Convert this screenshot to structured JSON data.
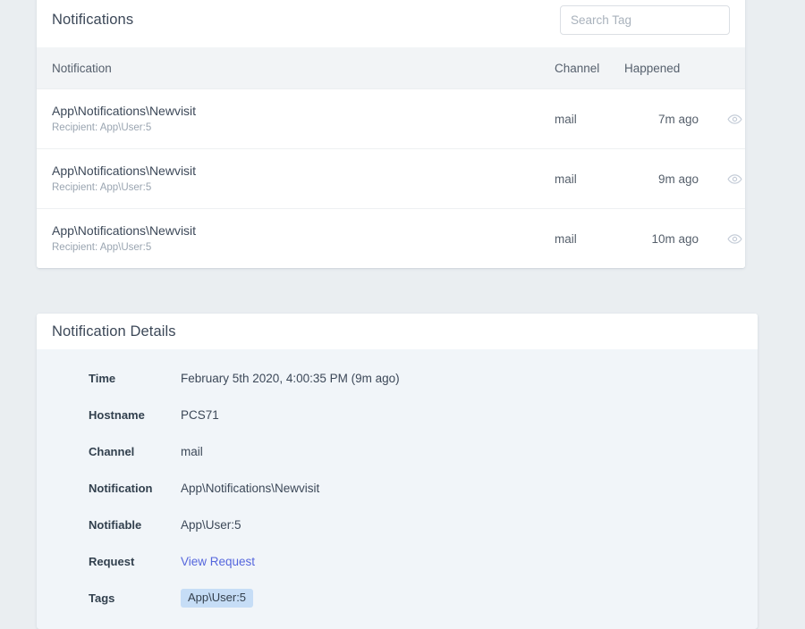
{
  "notifications_card": {
    "title": "Notifications",
    "search": {
      "placeholder": "Search Tag",
      "value": ""
    },
    "columns": {
      "notification": "Notification",
      "channel": "Channel",
      "happened": "Happened",
      "actions": ""
    },
    "rows": [
      {
        "notification": "App\\Notifications\\Newvisit",
        "recipient": "Recipient: App\\User:5",
        "channel": "mail",
        "happened": "7m ago",
        "action_icon": "eye-icon"
      },
      {
        "notification": "App\\Notifications\\Newvisit",
        "recipient": "Recipient: App\\User:5",
        "channel": "mail",
        "happened": "9m ago",
        "action_icon": "eye-icon"
      },
      {
        "notification": "App\\Notifications\\Newvisit",
        "recipient": "Recipient: App\\User:5",
        "channel": "mail",
        "happened": "10m ago",
        "action_icon": "eye-icon"
      }
    ]
  },
  "details_card": {
    "title": "Notification Details",
    "fields": [
      {
        "label": "Time",
        "value": "February 5th 2020, 4:00:35 PM (9m ago)",
        "type": "text"
      },
      {
        "label": "Hostname",
        "value": "PCS71",
        "type": "text"
      },
      {
        "label": "Channel",
        "value": "mail",
        "type": "text"
      },
      {
        "label": "Notification",
        "value": "App\\Notifications\\Newvisit",
        "type": "text"
      },
      {
        "label": "Notifiable",
        "value": "App\\User:5",
        "type": "text"
      },
      {
        "label": "Request",
        "value": "View Request",
        "type": "link"
      },
      {
        "label": "Tags",
        "value": "App\\User:5",
        "type": "tag"
      }
    ]
  },
  "colors": {
    "page_background": "#eaeef1",
    "card_background": "#ffffff",
    "details_background": "#f1f5f9",
    "table_header_background": "#f2f4f6",
    "title_text": "#3c4858",
    "muted_text": "#9aa5b1",
    "link": "#5566dd",
    "tag_background": "#c6ddf6",
    "icon": "#c5cdd8"
  }
}
